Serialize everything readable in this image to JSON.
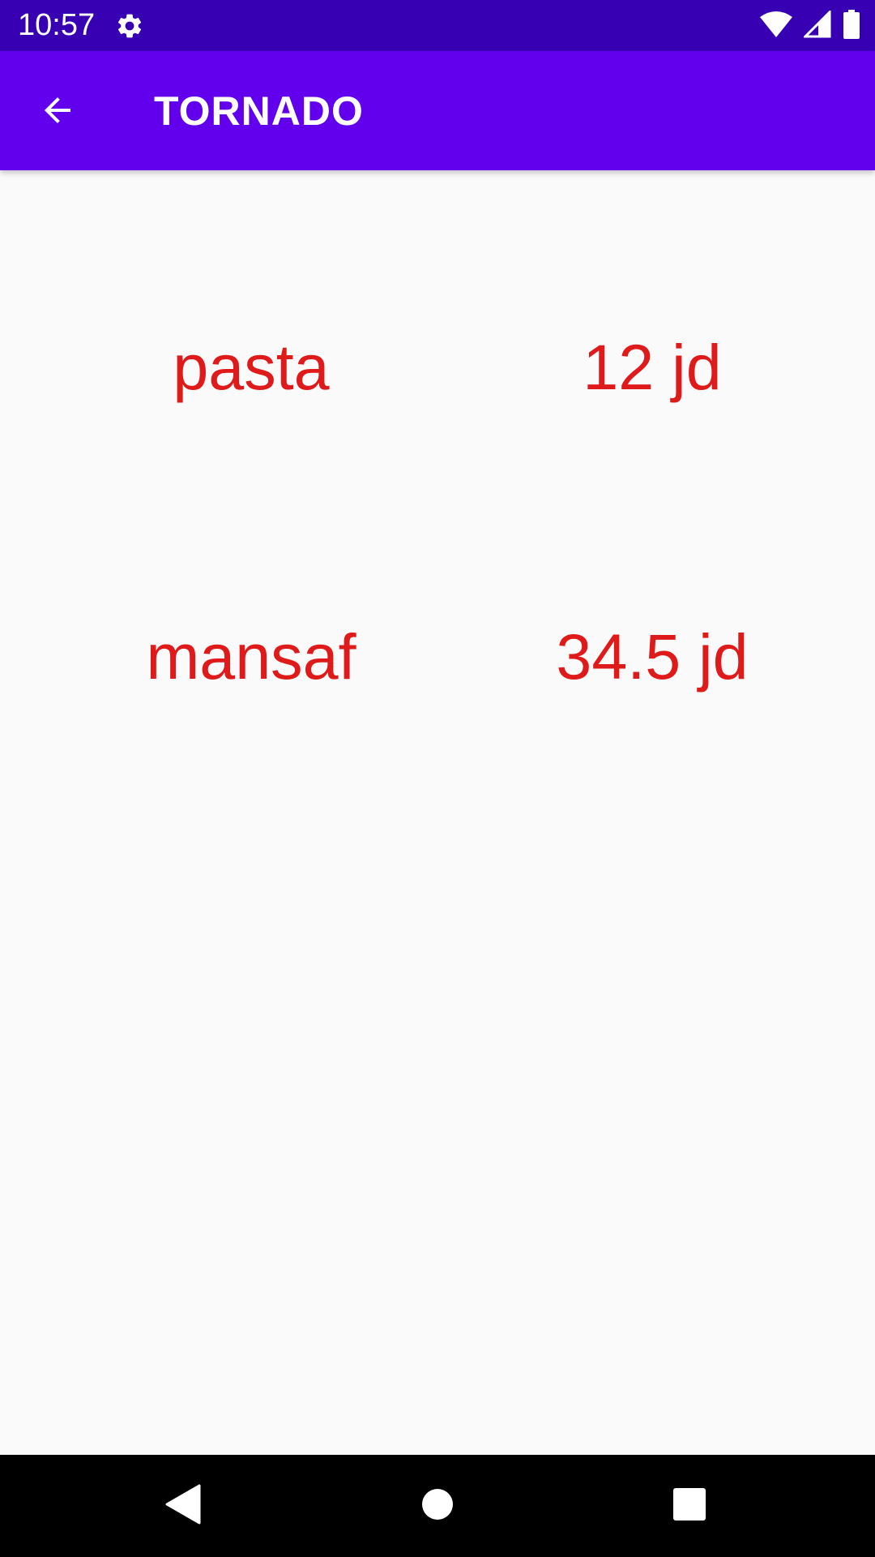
{
  "status_bar": {
    "time": "10:57",
    "icons": [
      "gear-icon",
      "wifi-icon",
      "signal-icon",
      "battery-icon"
    ]
  },
  "app_bar": {
    "title": "TORNADO",
    "back_icon": "arrow-back-icon",
    "color": "#6200ee",
    "status_color": "#3700b3"
  },
  "menu": {
    "text_color": "#de1a1a",
    "items": [
      {
        "name": "pasta",
        "price": "12 jd"
      },
      {
        "name": "mansaf",
        "price": "34.5 jd"
      }
    ]
  },
  "nav_bar": {
    "buttons": [
      "back-triangle-icon",
      "home-circle-icon",
      "recents-square-icon"
    ]
  }
}
